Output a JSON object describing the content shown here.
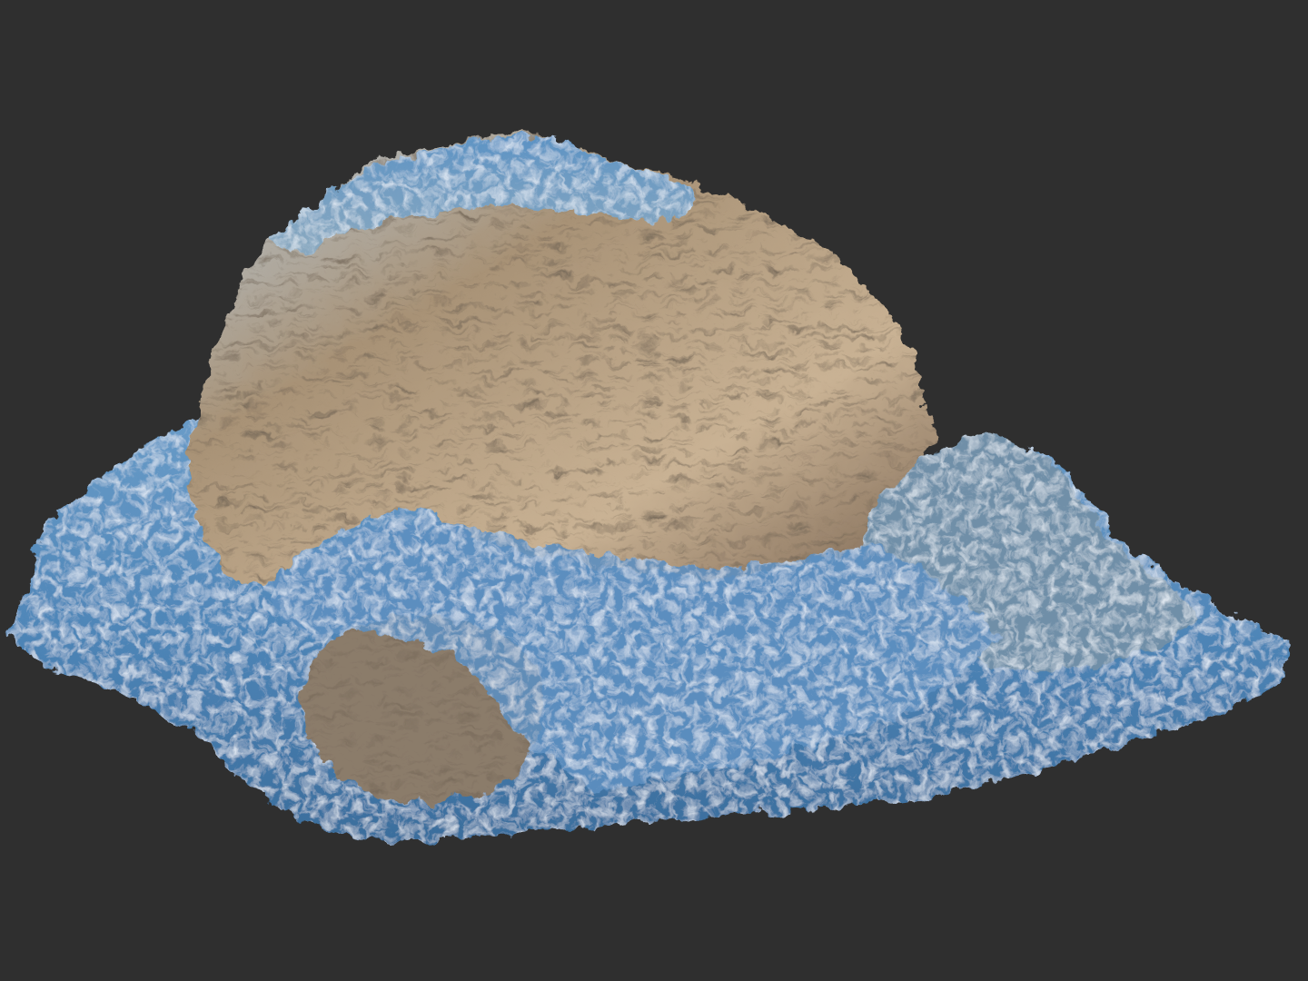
{
  "viewport": {
    "background_color": "#2f2f2f"
  },
  "model": {
    "kind": "3D scanned rock outcrop render",
    "colors": {
      "rock_light": "#d8c2a4",
      "rock_mid": "#9c8468",
      "rock_dark": "#4a3c30",
      "ground_blue": "#4f86b8",
      "ground_blue_dark": "#2c5277",
      "highlight": "#e6eef6"
    }
  }
}
